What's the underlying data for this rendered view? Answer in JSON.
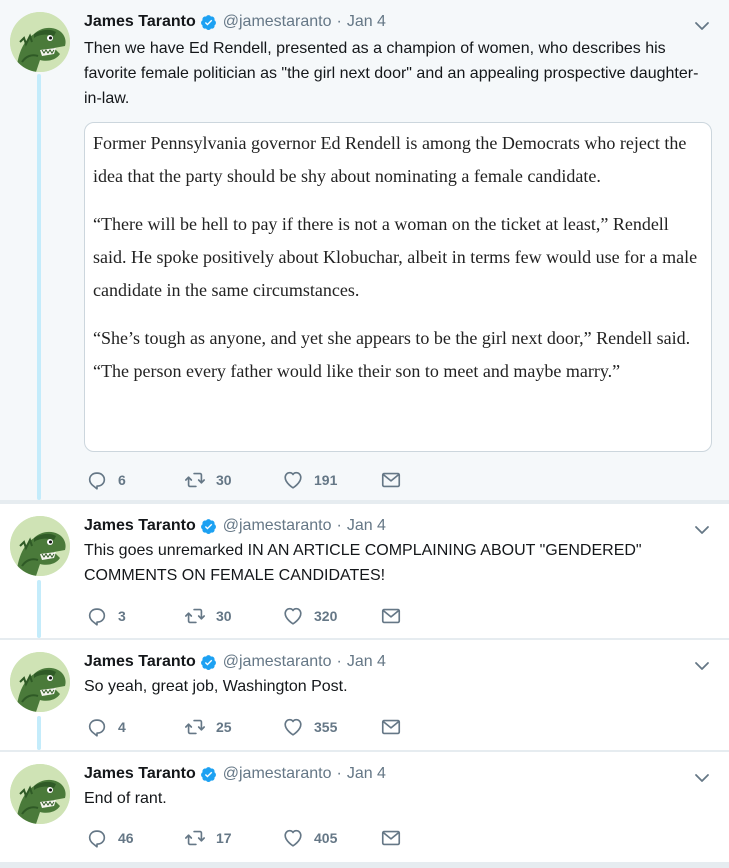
{
  "tweets": [
    {
      "name": "James Taranto",
      "handle": "@jamestaranto",
      "date": "Jan 4",
      "text": "Then we have Ed Rendell, presented as a champion of women, who describes his favorite female politician as \"the girl next door\" and an appealing prospective daughter-in-law.",
      "quote": [
        "Former Pennsylvania governor Ed Rendell is among the Democrats who reject the idea that the party should be shy about nominating a female candidate.",
        "“There will be hell to pay if there is not a woman on the ticket at least,” Rendell said. He spoke positively about Klobuchar, albeit in terms few would use for a male candidate in the same circumstances.",
        "“She’s tough as anyone, and yet she appears to be the girl next door,” Rendell said. “The person every father would like their son to meet and maybe marry.”"
      ],
      "replies": "6",
      "retweets": "30",
      "likes": "191"
    },
    {
      "name": "James Taranto",
      "handle": "@jamestaranto",
      "date": "Jan 4",
      "text": "This goes unremarked IN AN ARTICLE COMPLAINING ABOUT \"GENDERED\" COMMENTS ON FEMALE CANDIDATES!",
      "replies": "3",
      "retweets": "30",
      "likes": "320"
    },
    {
      "name": "James Taranto",
      "handle": "@jamestaranto",
      "date": "Jan 4",
      "text": "So yeah, great job, Washington Post.",
      "replies": "4",
      "retweets": "25",
      "likes": "355"
    },
    {
      "name": "James Taranto",
      "handle": "@jamestaranto",
      "date": "Jan 4",
      "text": "End of rant.",
      "replies": "46",
      "retweets": "17",
      "likes": "405"
    }
  ],
  "icons": {
    "reply": "reply-icon",
    "retweet": "retweet-icon",
    "like": "heart-icon",
    "dm": "mail-icon",
    "verified": "verified-badge-icon",
    "caret": "chevron-down-icon"
  },
  "colors": {
    "verified": "#1da1f2",
    "thread_line": "#c4ecfb",
    "muted": "#657786"
  }
}
